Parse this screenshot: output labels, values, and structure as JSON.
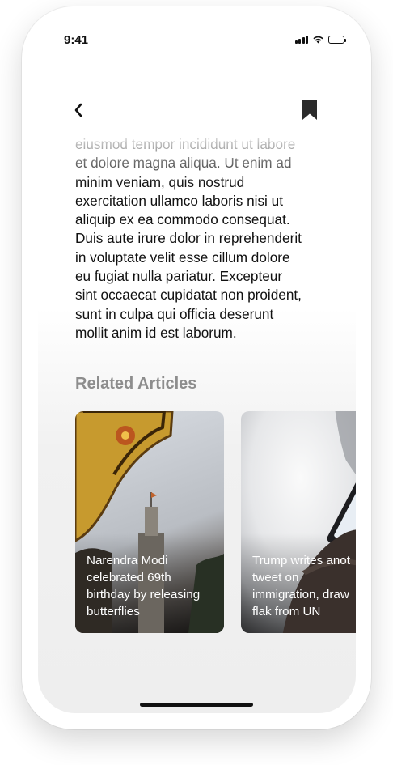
{
  "status_bar": {
    "time": "9:41"
  },
  "nav": {
    "back_icon": "chevron-left-icon",
    "bookmark_icon": "bookmark-icon"
  },
  "article": {
    "lines": [
      "eiusmod tempor incididunt ut labore",
      "et dolore magna aliqua. Ut enim ad",
      "minim veniam, quis nostrud",
      "exercitation ullamco laboris nisi ut",
      "aliquip ex ea commodo consequat.",
      "Duis aute irure dolor in reprehenderit",
      "in voluptate velit esse cillum dolore",
      "eu fugiat nulla pariatur. Excepteur",
      "sint occaecat cupidatat non proident,",
      "sunt in culpa qui officia deserunt",
      "mollit anim id est laborum."
    ]
  },
  "related": {
    "title": "Related Articles",
    "cards": [
      {
        "caption": [
          "Narendra Modi",
          "celebrated 69th",
          "birthday by releasing",
          "butterflies"
        ]
      },
      {
        "caption": [
          "Trump writes anot",
          "tweet on",
          "immigration, draw",
          "flak from UN"
        ]
      }
    ]
  },
  "colors": {
    "accent_text": "#111111",
    "muted_heading": "#8d8d8d",
    "card_text": "#ffffff"
  }
}
